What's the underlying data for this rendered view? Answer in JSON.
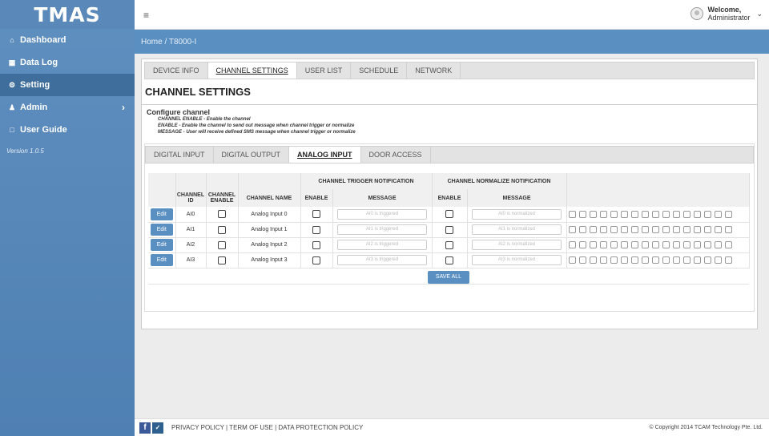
{
  "app": {
    "logo": "TMAS",
    "version": "Version 1.0.5"
  },
  "sidebar": {
    "items": [
      {
        "label": "Dashboard",
        "icon": "home-icon"
      },
      {
        "label": "Data Log",
        "icon": "table-icon"
      },
      {
        "label": "Setting",
        "icon": "gear-icon"
      },
      {
        "label": "Admin",
        "icon": "user-icon"
      },
      {
        "label": "User Guide",
        "icon": "document-icon"
      }
    ]
  },
  "header": {
    "welcome": "Welcome,",
    "user": "Administrator",
    "breadcrumb": "Home  /  T8000-I"
  },
  "main": {
    "tabs": [
      "DEVICE INFO",
      "CHANNEL SETTINGS",
      "USER LIST",
      "SCHEDULE",
      "NETWORK"
    ],
    "title": "CHANNEL SETTINGS",
    "config": {
      "title": "Configure channel",
      "lines": [
        "CHANNEL ENABLE - Enable the channel",
        "ENABLE - Enable the channel to send out message when channel trigger or normalize",
        "MESSAGE - User will receive defined SMS message when channel trigger or normalize"
      ]
    },
    "subtabs": [
      "DIGITAL INPUT",
      "DIGITAL OUTPUT",
      "ANALOG INPUT",
      "DOOR ACCESS"
    ],
    "table": {
      "group_trigger": "CHANNEL TRIGGER NOTIFICATION",
      "group_normalize": "CHANNEL NORMALIZE NOTIFICATION",
      "col_id": "CHANNEL ID",
      "col_channel_enable": "CHANNEL ENABLE",
      "col_name": "CHANNEL NAME",
      "col_enable": "ENABLE",
      "col_message": "MESSAGE",
      "edit_label": "Edit",
      "rows": [
        {
          "id": "AI0",
          "name": "Analog Input 0",
          "trigger_msg": "AI0 is triggered",
          "normal_msg": "AI0 is normalized"
        },
        {
          "id": "AI1",
          "name": "Analog Input 1",
          "trigger_msg": "AI1 is triggered",
          "normal_msg": "AI1 is normalized"
        },
        {
          "id": "AI2",
          "name": "Analog Input 2",
          "trigger_msg": "AI2 is triggered",
          "normal_msg": "AI2 is normalized"
        },
        {
          "id": "AI3",
          "name": "Analog Input 3",
          "trigger_msg": "AI3 is triggered",
          "normal_msg": "AI3 is normalized"
        }
      ],
      "save_label": "SAVE ALL"
    }
  },
  "footer": {
    "links": "PRIVACY POLICY | TERM OF USE | DATA PROTECTION POLICY",
    "copyright": "© Copyright 2014 TCAM Technology Pte. Ltd."
  },
  "colors": {
    "primary": "#5a8fc1",
    "sidebar": "#4f80b3",
    "active_nav": "#3f6e9c"
  }
}
